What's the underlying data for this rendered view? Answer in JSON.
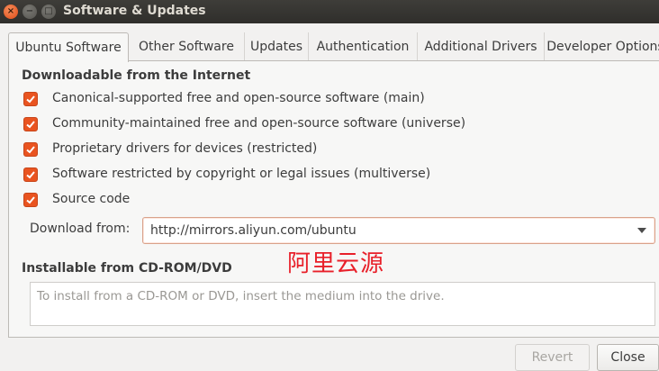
{
  "window": {
    "title": "Software & Updates",
    "close_glyph": "×",
    "minimize_glyph": "−",
    "maximize_glyph": "□"
  },
  "tabs": [
    {
      "label": "Ubuntu Software",
      "active": true
    },
    {
      "label": "Other Software",
      "active": false
    },
    {
      "label": "Updates",
      "active": false
    },
    {
      "label": "Authentication",
      "active": false
    },
    {
      "label": "Additional Drivers",
      "active": false
    },
    {
      "label": "Developer Options",
      "active": false
    }
  ],
  "downloadable": {
    "title": "Downloadable from the Internet",
    "items": [
      {
        "label": "Canonical-supported free and open-source software (main)",
        "checked": true
      },
      {
        "label": "Community-maintained free and open-source software (universe)",
        "checked": true
      },
      {
        "label": "Proprietary drivers for devices (restricted)",
        "checked": true
      },
      {
        "label": "Software restricted by copyright or legal issues (multiverse)",
        "checked": true
      },
      {
        "label": "Source code",
        "checked": true
      }
    ],
    "download_from_label": "Download from:",
    "download_from_value": "http://mirrors.aliyun.com/ubuntu"
  },
  "annotation": "阿里云源",
  "cdrom": {
    "title": "Installable from CD-ROM/DVD",
    "hint": "To install from a CD-ROM or DVD, insert the medium into the drive."
  },
  "buttons": {
    "revert": "Revert",
    "close": "Close"
  },
  "colors": {
    "accent": "#e95420",
    "annotation": "#e8202a"
  }
}
